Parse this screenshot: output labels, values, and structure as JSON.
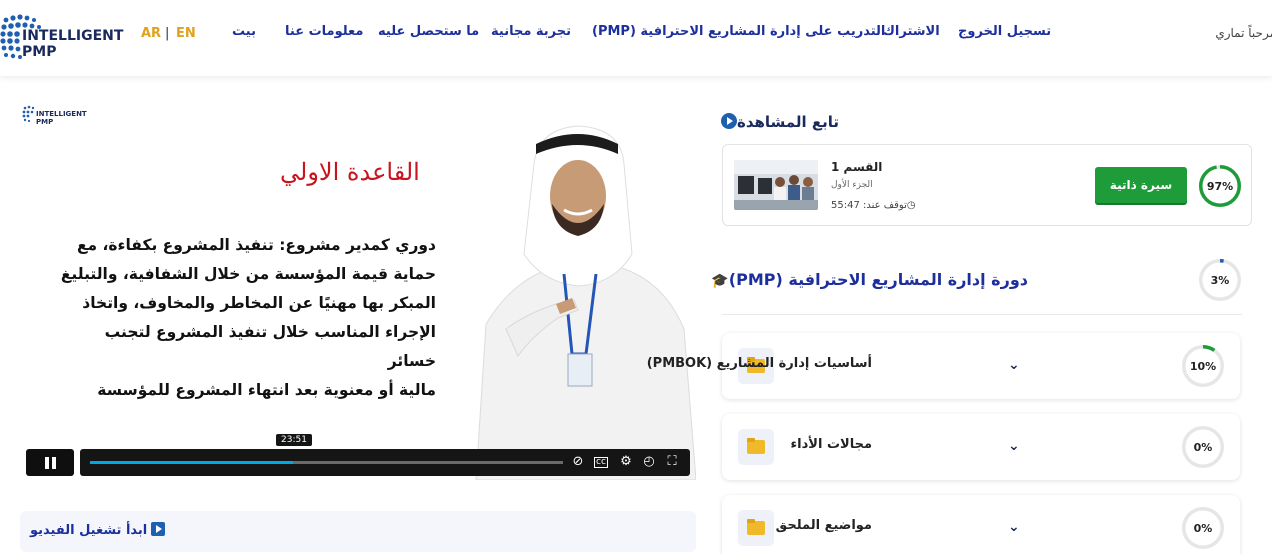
{
  "colors": {
    "brand_blue": "#1d2f9c",
    "gold": "#e0a21c",
    "green": "#1e9c3a",
    "red_title": "#c8141e",
    "progress": "#00a8e6"
  },
  "header": {
    "logo": {
      "line1": "INTELLIGENT",
      "line2": "PMP"
    },
    "lang_ar": "AR",
    "lang_sep": "|",
    "lang_en": "EN",
    "nav": [
      {
        "label": "بيت"
      },
      {
        "label": "معلومات عنا"
      },
      {
        "label": "ما ستحصل عليه"
      },
      {
        "label": "تجربة مجانية"
      },
      {
        "label": "التدريب على إدارة المشاريع الاحترافية (PMP)"
      },
      {
        "label": "الاشتراك"
      },
      {
        "label": "تسجيل الخروج"
      }
    ],
    "greeting": "مرحباً تماري"
  },
  "video": {
    "logo": {
      "line1": "INTELLIGENT",
      "line2": "PMP"
    },
    "slide_title": "القاعدة الاولي",
    "slide_lines": [
      "دوري كمدير مشروع: تنفيذ المشروع بكفاءة، مع",
      "حماية قيمة المؤسسة من خلال الشفافية، والتبليغ",
      "المبكر بها مهنيًا عن المخاطر والمخاوف، واتخاذ",
      "الإجراء المناسب خلال تنفيذ المشروع لتجنب خسائر",
      "مالية أو معنوية بعد انتهاء المشروع للمؤسسة"
    ],
    "current_time": "23:51",
    "progress": 0.43,
    "start_label": "ابدأ تشغيل الفيديو"
  },
  "continue": {
    "title": "تابع المشاهدة",
    "section_title": "القسم 1",
    "section_sub": "الجزء الأول",
    "stopped_at": "توقف عند: 55:47",
    "bio_button": "سيرة ذاتية",
    "progress_pct": 97,
    "progress_label": "97%"
  },
  "course": {
    "title": "دورة إدارة المشاريع الاحترافية (PMP)",
    "icon": "graduation-cap-icon",
    "progress_pct": 3,
    "progress_label": "3%"
  },
  "modules": [
    {
      "title": "أساسيات إدارة المشاريع (PMBOK)",
      "progress_pct": 10,
      "progress_label": "10%"
    },
    {
      "title": "مجالات الأداء",
      "progress_pct": 0,
      "progress_label": "0%"
    },
    {
      "title": "مواضيع الملحق",
      "progress_pct": 0,
      "progress_label": "0%"
    }
  ]
}
